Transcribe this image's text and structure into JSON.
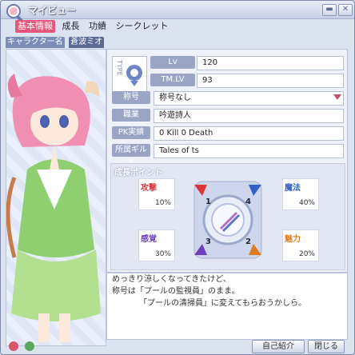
{
  "window": {
    "title": "マイビュー"
  },
  "tabs": [
    {
      "label": "基本情報"
    },
    {
      "label": "成長"
    },
    {
      "label": "功績"
    },
    {
      "label": "シークレット"
    }
  ],
  "character": {
    "name_label": "キャラクター名",
    "name_value": "蒼波ミオ"
  },
  "profile": {
    "type_label": "TYPE",
    "lv_label": "Lv",
    "lv_value": "120",
    "tmlv_label": "TM.LV",
    "tmlv_value": "93",
    "title_label": "称号",
    "title_value": "称号なし",
    "job_label": "職業",
    "job_value": "吟遊詩人",
    "pk_label": "PK実績",
    "pk_value": "0 Kill 0 Death",
    "guild_label": "所属ギルド",
    "guild_value": "Tales of ts"
  },
  "growth": {
    "title": "成長ポイント",
    "stats": [
      {
        "name": "攻撃",
        "value": "10%",
        "color": "#d9363e"
      },
      {
        "name": "魔法",
        "value": "40%",
        "color": "#2f5fc9"
      },
      {
        "name": "感覚",
        "value": "30%",
        "color": "#6f3fbf"
      },
      {
        "name": "魅力",
        "value": "20%",
        "color": "#e07b1b"
      }
    ],
    "markers": [
      "1",
      "4",
      "3",
      "2"
    ]
  },
  "message": {
    "lines": [
      "めっきり涼しくなってきたけど、",
      "称号は「プールの監視員」のまま。",
      "",
      "「プールの清掃員」に変えてもらおうかしら。"
    ]
  },
  "buttons": {
    "self_intro": "自己紹介",
    "close": "閉じる"
  }
}
